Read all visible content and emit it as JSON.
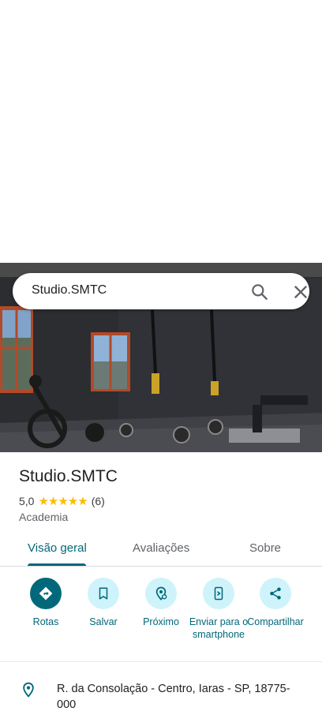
{
  "search": {
    "query": "Studio.SMTC",
    "search_icon": "search-icon",
    "close_icon": "close-icon"
  },
  "photo": {
    "description_icon": "place-photo"
  },
  "place": {
    "name": "Studio.SMTC",
    "rating": "5,0",
    "stars": "★★★★★",
    "star_count": 5,
    "review_count": "(6)",
    "category": "Academia"
  },
  "tabs": [
    {
      "label": "Visão geral",
      "active": true
    },
    {
      "label": "Avaliações",
      "active": false
    },
    {
      "label": "Sobre",
      "active": false
    }
  ],
  "actions": [
    {
      "label": "Rotas",
      "icon": "directions-icon"
    },
    {
      "label": "Salvar",
      "icon": "bookmark-icon"
    },
    {
      "label": "Próximo",
      "icon": "nearby-icon"
    },
    {
      "label": "Enviar para o smartphone",
      "icon": "send-to-phone-icon"
    },
    {
      "label": "Compartilhar",
      "icon": "share-icon"
    }
  ],
  "address": {
    "text": "R. da Consolação - Centro, Iaras - SP, 18775-000",
    "icon": "location-pin-icon"
  },
  "colors": {
    "accent": "#00687a",
    "action_bg": "#cff3fa",
    "star": "#fbbc04"
  }
}
